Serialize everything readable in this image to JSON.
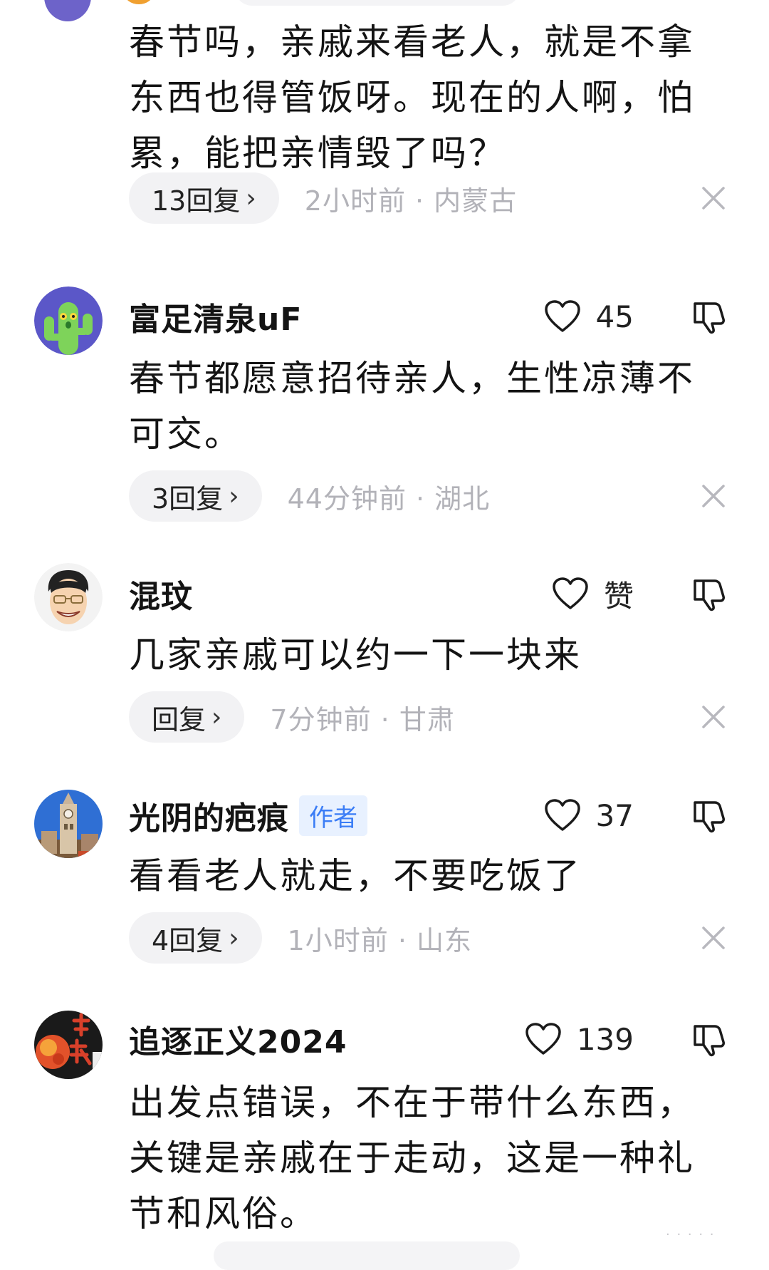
{
  "comments": [
    {
      "username": "",
      "content": "春节吗，亲戚来看老人，就是不拿\n东西也得管饭呀。现在的人啊，怕\n累，能把亲情毁了吗？",
      "reply_label": "13回复",
      "meta": "2小时前 · 内蒙古"
    },
    {
      "username": "富足清泉uF",
      "likes": "45",
      "content": "春节都愿意招待亲人，生性凉薄不\n可交。",
      "reply_label": "3回复",
      "meta": "44分钟前 · 湖北"
    },
    {
      "username": "混玟",
      "likes": "赞",
      "content": "几家亲戚可以约一下一块来",
      "reply_label": "回复",
      "meta": "7分钟前 · 甘肃"
    },
    {
      "username": "光阴的疤痕",
      "author_tag": "作者",
      "likes": "37",
      "content": "看看老人就走，不要吃饭了",
      "reply_label": "4回复",
      "meta": "1小时前 · 山东"
    },
    {
      "username": "追逐正义2024",
      "likes": "139",
      "content": "出发点错误，不在于带什么东西，\n关键是亲戚在于走动，这是一种礼\n节和风俗。"
    }
  ],
  "icons": {
    "like": "heart-outline-icon",
    "dislike": "thumbs-down-icon",
    "close": "close-icon",
    "reply_chevron": "chevron-right-icon"
  },
  "colors": {
    "author_tag_text": "#3b7df6",
    "author_tag_bg": "#e8f1ff",
    "meta_text": "#b2b2b8",
    "pill_bg": "#f2f2f4"
  }
}
